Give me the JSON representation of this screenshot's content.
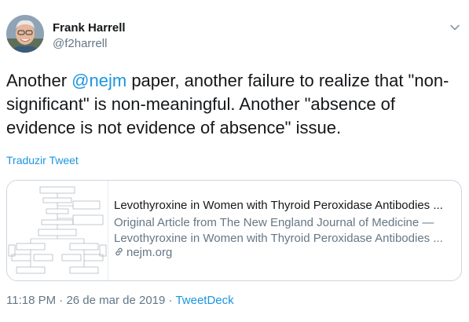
{
  "author": {
    "display_name": "Frank Harrell",
    "handle": "@f2harrell"
  },
  "tweet": {
    "text_before_mention": "Another ",
    "mention": "@nejm",
    "text_after_mention": " paper, another failure to realize that \"non-significant\" is non-meaningful.  Another \"absence of evidence is not evidence of absence\" issue."
  },
  "translate_label": "Traduzir Tweet",
  "card": {
    "title": "Levothyroxine in Women with Thyroid Peroxidase Antibodies ...",
    "description_line1": "Original Article from The New England Journal of Medicine —",
    "description_line2": "Levothyroxine in Women with Thyroid Peroxidase Antibodies ...",
    "domain": "nejm.org"
  },
  "meta": {
    "time": "11:18 PM",
    "separator": " · ",
    "date": "26 de mar de 2019",
    "source": "TweetDeck"
  },
  "icons": {
    "caret": "chevron-down-icon",
    "link": "link-icon"
  },
  "colors": {
    "link_blue": "#1b95e0",
    "secondary_text": "#657786",
    "primary_text": "#14171a",
    "card_border": "#ccd6dd"
  }
}
